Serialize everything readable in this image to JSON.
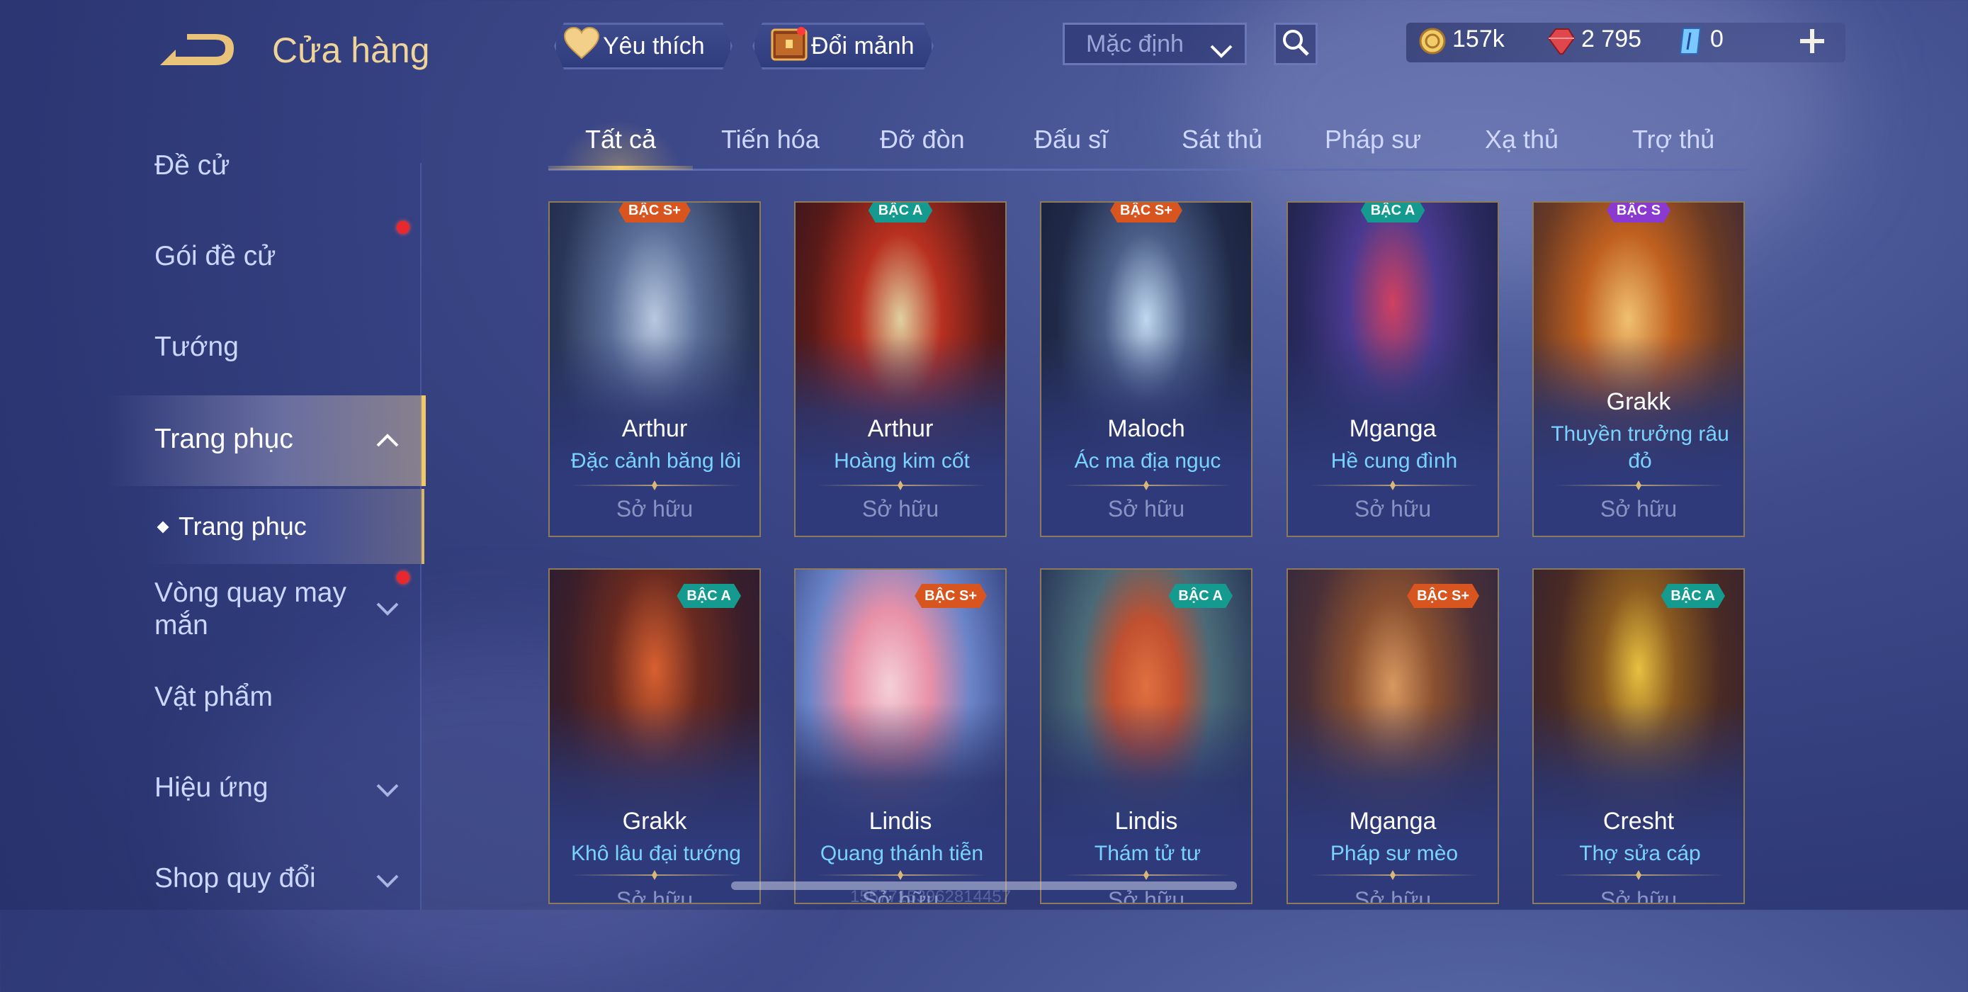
{
  "header": {
    "title": "Cửa hàng",
    "favorites_label": "Yêu thích",
    "exchange_label": "Đổi mảnh",
    "sort_value": "Mặc định"
  },
  "currency": {
    "gold": "157k",
    "gems": "2 795",
    "tokens": "0"
  },
  "sidebar": {
    "items": [
      {
        "label": "Đề cử"
      },
      {
        "label": "Gói đề cử"
      },
      {
        "label": "Tướng"
      },
      {
        "label": "Trang phục"
      },
      {
        "label": "Trang phục"
      },
      {
        "label": "Vòng quay may mắn"
      },
      {
        "label": "Vật phẩm"
      },
      {
        "label": "Hiệu ứng"
      },
      {
        "label": "Shop quy đổi"
      }
    ]
  },
  "tabs": [
    {
      "label": "Tất cả"
    },
    {
      "label": "Tiến hóa"
    },
    {
      "label": "Đỡ đòn"
    },
    {
      "label": "Đấu sĩ"
    },
    {
      "label": "Sát thủ"
    },
    {
      "label": "Pháp sư"
    },
    {
      "label": "Xạ thủ"
    },
    {
      "label": "Trợ thủ"
    }
  ],
  "cards": [
    {
      "hero": "Arthur",
      "skin": "Đặc cảnh băng lôi",
      "rank": "BẬC S+",
      "status": "Sở hữu"
    },
    {
      "hero": "Arthur",
      "skin": "Hoàng kim cốt",
      "rank": "BẬC A",
      "status": "Sở hữu"
    },
    {
      "hero": "Maloch",
      "skin": "Ác ma địa ngục",
      "rank": "BẬC S+",
      "status": "Sở hữu"
    },
    {
      "hero": "Mganga",
      "skin": "Hề cung đình",
      "rank": "BẬC A",
      "status": "Sở hữu"
    },
    {
      "hero": "Grakk",
      "skin": "Thuyền trưởng râu đỏ",
      "rank": "BẬC S",
      "status": "Sở hữu"
    },
    {
      "hero": "Grakk",
      "skin": "Khô lâu đại tướng",
      "rank": "BẬC A",
      "status": "Sở hữu"
    },
    {
      "hero": "Lindis",
      "skin": "Quang thánh tiễn",
      "rank": "BẬC S+",
      "status": "Sở hữu"
    },
    {
      "hero": "Lindis",
      "skin": "Thám tử tư",
      "rank": "BẬC A",
      "status": "Sở hữu"
    },
    {
      "hero": "Mganga",
      "skin": "Pháp sư mèo",
      "rank": "BẬC S+",
      "status": "Sở hữu"
    },
    {
      "hero": "Cresht",
      "skin": "Thợ sửa cáp",
      "rank": "BẬC A",
      "status": "Sở hữu"
    }
  ],
  "footer_id": "15577153962814457",
  "colors": {
    "accent_gold": "#f0c866",
    "skin_name_blue": "#7ad3ff",
    "badge_splus": "#d8551f",
    "badge_a": "#149a8e",
    "badge_s": "#8a3ad0",
    "notification_red": "#e8282c"
  }
}
